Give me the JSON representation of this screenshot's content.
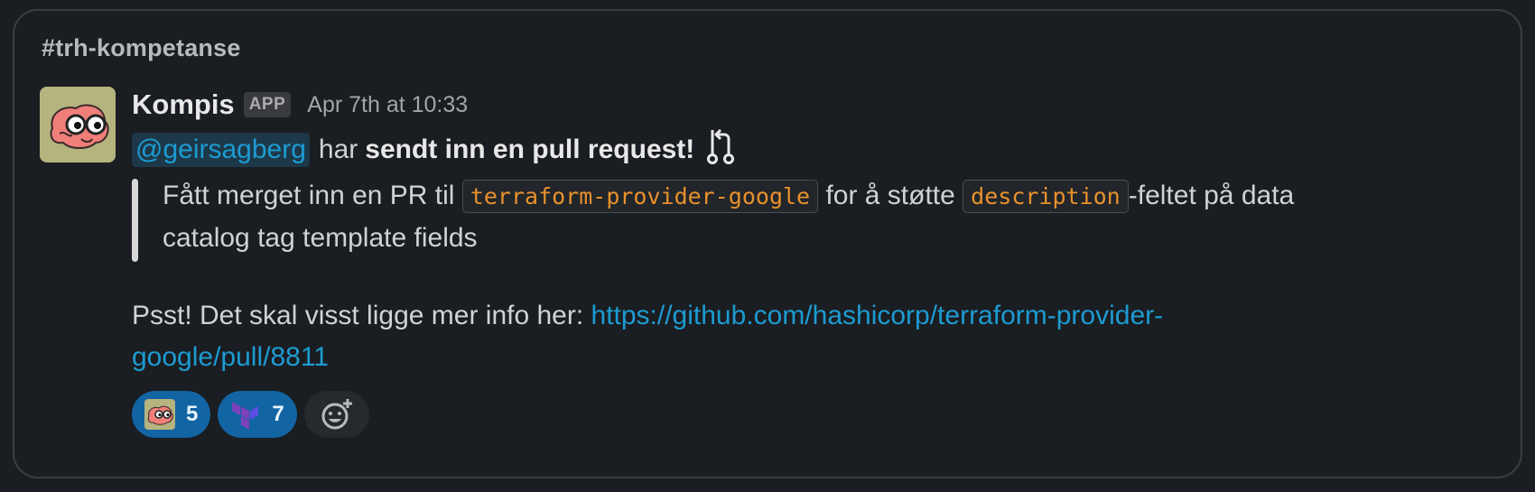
{
  "channel": "#trh-kompetanse",
  "message": {
    "sender": "Kompis",
    "badge": "APP",
    "timestamp": "Apr 7th at 10:33",
    "mention": "@geirsagberg",
    "verb": "har",
    "action_bold": "sendt inn en pull request!",
    "pr_icon": "pull-request-icon",
    "quote": {
      "part1": "Fått merget inn en PR til ",
      "code1": "terraform-provider-google",
      "part2": " for å støtte ",
      "code2": "description",
      "part3": "-feltet på data catalog tag template fields"
    },
    "psst_text": "Psst! Det skal visst ligge mer info her: ",
    "link": "https://github.com/hashicorp/terraform-provider-google/pull/8811"
  },
  "reactions": [
    {
      "emoji": "brain-glasses-emoji",
      "count": "5"
    },
    {
      "emoji": "terraform-emoji",
      "count": "7"
    }
  ],
  "add_reaction_icon": "add-reaction-icon",
  "colors": {
    "background": "#1a1d21",
    "link": "#1d9bd1",
    "code": "#e8912d",
    "reaction": "#1264a3",
    "avatar_bg": "#b5b37e"
  }
}
